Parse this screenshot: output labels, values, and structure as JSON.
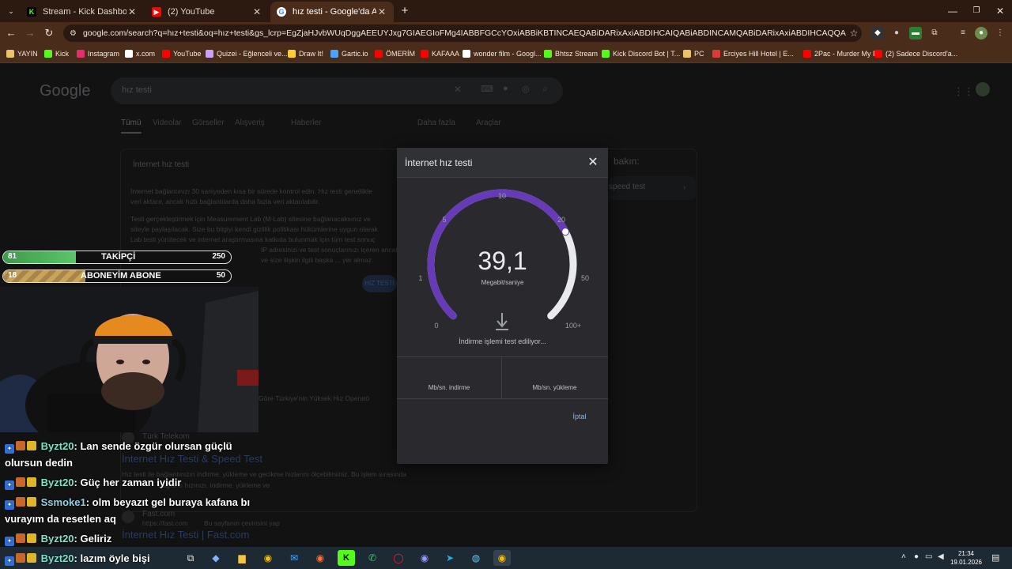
{
  "browser": {
    "tabs": [
      {
        "title": "Stream - Kick Dashboard",
        "icon": "kick-icon",
        "color": "#53fc18",
        "active": false
      },
      {
        "title": "(2) YouTube",
        "icon": "youtube-icon",
        "color": "#ff0000",
        "active": false
      },
      {
        "title": "hız testi - Google'da Ara",
        "icon": "google-icon",
        "color": "#ffffff",
        "active": true
      }
    ],
    "new_tab_glyph": "+",
    "url": "google.com/search?q=hız+testi&oq=hız+testi&gs_lcrp=EgZjaHJvbWUqDggAEEUYJxg7GIAEGIoFMg4IABBFGCcYOxiABBiKBTINCAEQABiDARixAxiABDIHCAIQABiABDINCAMQABiDARixAxiABDIHCAQQABiDARixAxiABDIHCAUQABiDARixAxiABDIHCAYQABiABDIHCAcQABiDARixAxiABDIHCAgQABiABDI...",
    "bookmarks": [
      {
        "label": "YAYIN",
        "icon": "folder-icon",
        "color": "#e8c36a"
      },
      {
        "label": "Kick",
        "icon": "kick-icon",
        "color": "#53fc18"
      },
      {
        "label": "Instagram",
        "icon": "instagram-icon",
        "color": "#e1306c"
      },
      {
        "label": "x.com",
        "icon": "x-icon",
        "color": "#ffffff"
      },
      {
        "label": "YouTube",
        "icon": "youtube-icon",
        "color": "#ff0000"
      },
      {
        "label": "Quizei - Eğlenceli ve...",
        "icon": "quiz-icon",
        "color": "#c9a0ff"
      },
      {
        "label": "Draw It!",
        "icon": "draw-icon",
        "color": "#ffcc33"
      },
      {
        "label": "Gartic.io",
        "icon": "gartic-icon",
        "color": "#4aa3ff"
      },
      {
        "label": "ÖMERİM",
        "icon": "youtube-icon",
        "color": "#ff0000"
      },
      {
        "label": "KAFAAA",
        "icon": "youtube-icon",
        "color": "#ff0000"
      },
      {
        "label": "wonder film - Googl...",
        "icon": "google-icon",
        "color": "#ffffff"
      },
      {
        "label": "Bhtsz Stream",
        "icon": "kick-icon",
        "color": "#53fc18"
      },
      {
        "label": "Kick Discord Bot | T...",
        "icon": "kick-icon",
        "color": "#53fc18"
      },
      {
        "label": "PC",
        "icon": "folder-icon",
        "color": "#e8c36a"
      },
      {
        "label": "Erciyes Hill Hotel | E...",
        "icon": "hotel-icon",
        "color": "#d93b3b"
      },
      {
        "label": "2Pac - Murder My F...",
        "icon": "youtube-icon",
        "color": "#ff0000"
      },
      {
        "label": "(2) Sadece Discord'a...",
        "icon": "youtube-icon",
        "color": "#ff0000"
      }
    ]
  },
  "google": {
    "logo": "Google",
    "query": "hız testi",
    "tabs": [
      "Tümü",
      "Videolar",
      "Görseller",
      "Alışveriş",
      "Haberler",
      "Daha fazla",
      "Araçlar"
    ],
    "card_title": "İnternet hız testi",
    "body_lines": [
      "İnternet bağlantınızı 30 saniyeden kısa bir sürede kontrol edin. Hız testi genellikle",
      "veri aktarır, ancak hızlı bağlantılarda daha fazla veri aktarılabilir.",
      "Testi gerçekleştirmek için Measurement Lab (M-Lab) sitesine bağlanacaksınız ve",
      "siteyle paylaşılacak. Size bu bilgiyi kendi gizlilik politikası hükümlerine uygun olarak",
      "Lab testi yürütecek ve internet araştırmasına katkıda bulunmak için tüm test sonuç",
      "IP adresinizi ve test sonuçlarınızı içeren ancak",
      "ve size ilişkin ilgili başka ... yer almaz."
    ],
    "side_label": "bakın:",
    "side_link": "speed test",
    "run_button": "HIZ TESTİ",
    "results": [
      {
        "meta": "Göre Türkiye'nin Yüksek Hız Operatö",
        "source": "Türk Telekom",
        "title": "İnternet Hız Testi & Speed Test",
        "snippet": "Hız testi ile bağlantınızın indirme, yükleme ve gecikme hızlarını ölçebilirsiniz. Bu işlem sırasında",
        "snippet2": "Bağlantı hızınızı, indirme, yükleme ve"
      },
      {
        "source": "Fast.com",
        "url": "https://fast.com",
        "extra": "Bu sayfanın çevirisini yap",
        "title": "İnternet Hız Testi | Fast.com"
      }
    ]
  },
  "overlay": {
    "followers": {
      "left": "81",
      "label": "TAKİPÇİ",
      "right": "250",
      "progress": 0.32,
      "color": "#5cc46a"
    },
    "subs": {
      "left": "18",
      "label": "ABONEYİM ABONE",
      "right": "50",
      "progress": 0.36,
      "color": "#c8a35a"
    },
    "chat": [
      {
        "user": "Byzt20",
        "text": ": Lan sende özgür olursan güçlü olursun dedin"
      },
      {
        "user": "Byzt20",
        "text": ": Güç her zaman iyidir"
      },
      {
        "user": "Ssmoke1",
        "text": ": olm beyazıt gel buraya kafana bı vurayım da resetlen aq"
      },
      {
        "user": "Byzt20",
        "text": ": Geliriz"
      },
      {
        "user": "Byzt20",
        "text": ": lazım öyle bişi"
      }
    ]
  },
  "speedtest": {
    "title": "İnternet hız testi",
    "close_glyph": "✕",
    "ticks": [
      "0",
      "1",
      "5",
      "10",
      "20",
      "50",
      "100+"
    ],
    "value": "39,1",
    "unit": "Megabit/saniye",
    "status": "İndirme işlemi test ediliyor...",
    "download_label": "Mb/sn. indirme",
    "upload_label": "Mb/sn. yükleme",
    "cancel": "İptal",
    "accent": "#673ab7",
    "gauge_progress": 0.73
  },
  "taskbar": {
    "apps": [
      "windows-icon",
      "search-icon",
      "taskview-icon",
      "copilot-icon",
      "files-icon",
      "chrome-icon",
      "mail-icon",
      "firefox-icon",
      "kick-icon",
      "whatsapp-icon",
      "opera-icon",
      "discord-icon",
      "telegram-icon",
      "steam-icon",
      "chrome-icon"
    ],
    "time": "21:34",
    "date": "19.01.2026"
  }
}
